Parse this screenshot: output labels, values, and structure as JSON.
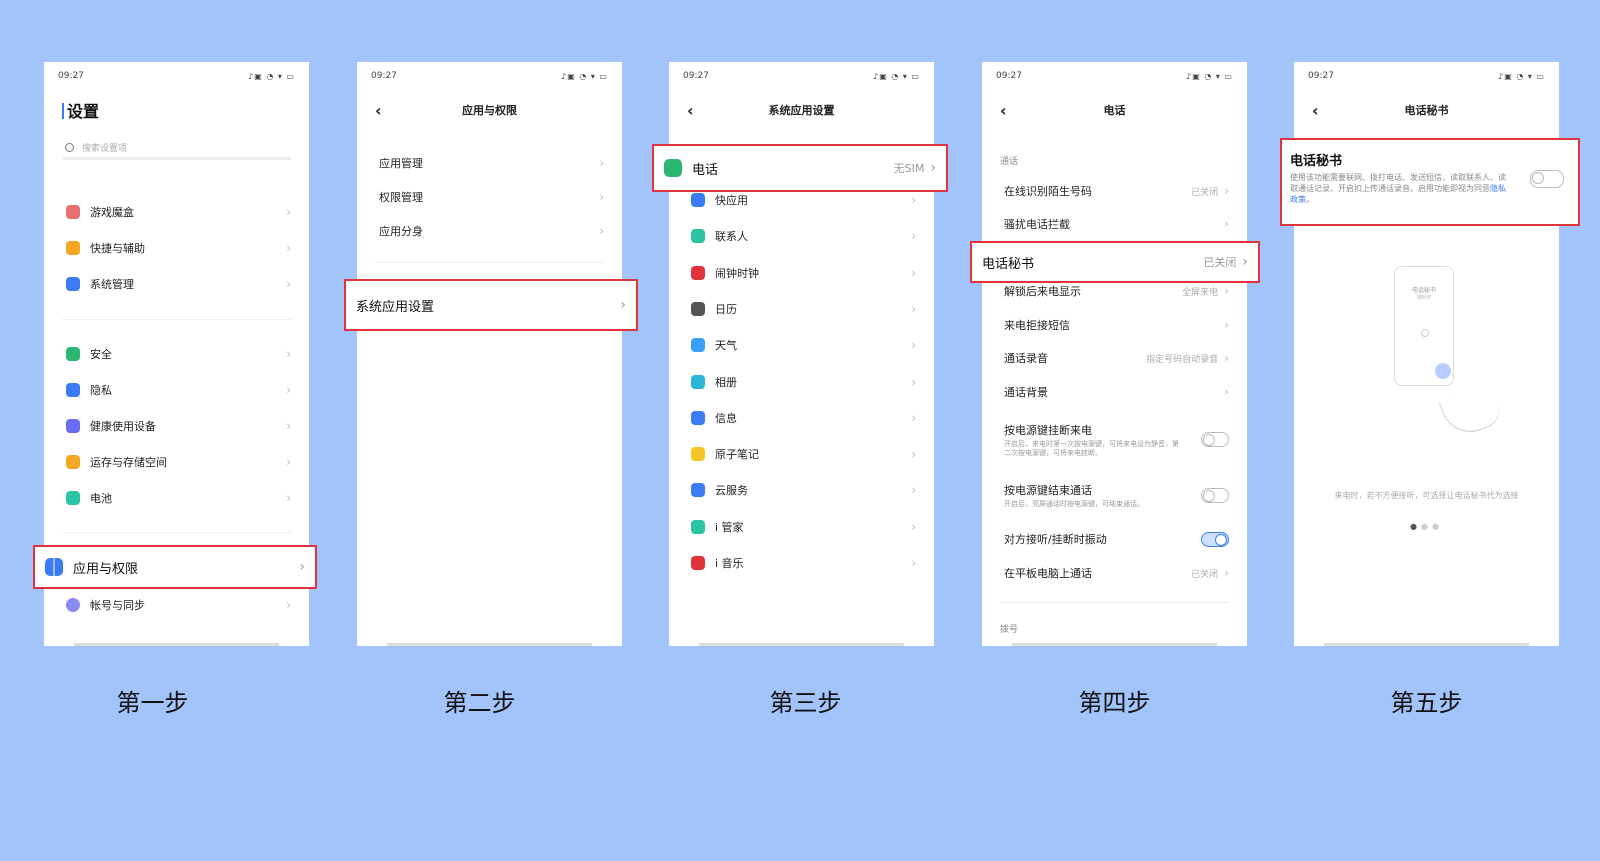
{
  "status_time": "09:27",
  "status_icons": "♪▣ ◔ ▾ ▭",
  "phone1": {
    "title": "设置",
    "search_placeholder": "搜索设置项",
    "items": [
      {
        "label": "游戏魔盒",
        "color": "#e86f6f"
      },
      {
        "label": "快捷与辅助",
        "color": "#f5a623"
      },
      {
        "label": "系统管理",
        "color": "#3b7bf6"
      },
      {
        "label": "安全",
        "color": "#2bb673"
      },
      {
        "label": "隐私",
        "color": "#3b7bf6"
      },
      {
        "label": "健康使用设备",
        "color": "#6c6cf0"
      },
      {
        "label": "运存与存储空间",
        "color": "#f5a623"
      },
      {
        "label": "电池",
        "color": "#2bc4a4"
      }
    ],
    "highlight": "应用与权限",
    "after": "帐号与同步"
  },
  "phone2": {
    "title": "应用与权限",
    "items": [
      "应用管理",
      "权限管理",
      "应用分身"
    ],
    "highlight": "系统应用设置"
  },
  "phone3": {
    "title": "系统应用设置",
    "highlight": {
      "label": "电话",
      "value": "无SIM"
    },
    "items": [
      {
        "label": "快应用",
        "color": "#3b7bf6"
      },
      {
        "label": "联系人",
        "color": "#2bc4a4"
      },
      {
        "label": "闹钟时钟",
        "color": "#e0343c"
      },
      {
        "label": "日历",
        "color": "#555555"
      },
      {
        "label": "天气",
        "color": "#3ba0f6"
      },
      {
        "label": "相册",
        "color": "#2bb6d8"
      },
      {
        "label": "信息",
        "color": "#3b7bf6"
      },
      {
        "label": "原子笔记",
        "color": "#f5c623"
      },
      {
        "label": "云服务",
        "color": "#3b7bf6"
      },
      {
        "label": "i 管家",
        "color": "#2bc4a4"
      },
      {
        "label": "i 音乐",
        "color": "#e0343c"
      }
    ]
  },
  "phone4": {
    "title": "电话",
    "section1": "通话",
    "rows_top": [
      {
        "label": "在线识别陌生号码",
        "value": "已关闭"
      },
      {
        "label": "骚扰电话拦截",
        "value": ""
      }
    ],
    "highlight": {
      "label": "电话秘书",
      "value": "已关闭"
    },
    "rows_mid": [
      {
        "label": "解锁后来电显示",
        "value": "全屏来电"
      },
      {
        "label": "来电拒接短信",
        "value": ""
      },
      {
        "label": "通话录音",
        "value": "指定号码自动录音"
      },
      {
        "label": "通话背景",
        "value": ""
      }
    ],
    "toggle1": {
      "label": "按电源键挂断来电",
      "desc": "开启后，来电时第一次按电源键，可将来电设为静音，第二次按电源键，可将来电挂断。"
    },
    "toggle2": {
      "label": "按电源键结束通话",
      "desc": "开启后，亮屏通话时按电源键，可结束通话。"
    },
    "toggle3": {
      "label": "对方接听/挂断时振动"
    },
    "last": {
      "label": "在平板电脑上通话",
      "value": "已关闭"
    },
    "section2": "拨号"
  },
  "phone5": {
    "title": "电话秘书",
    "card_title": "电话秘书",
    "card_desc": "使用该功能需要联网、拨打电话、发送短信、读取联系人、读取通话记录、开启扣上传通话录音。启用功能即视为同意",
    "card_link": "隐私政策",
    "card_end": "。",
    "illus_caption": "来电时，若不方便接听，可选择让电话秘书代为选接",
    "illus_text1": "电话秘书",
    "illus_text2": "接听中"
  },
  "steps": [
    "第一步",
    "第二步",
    "第三步",
    "第四步",
    "第五步"
  ]
}
